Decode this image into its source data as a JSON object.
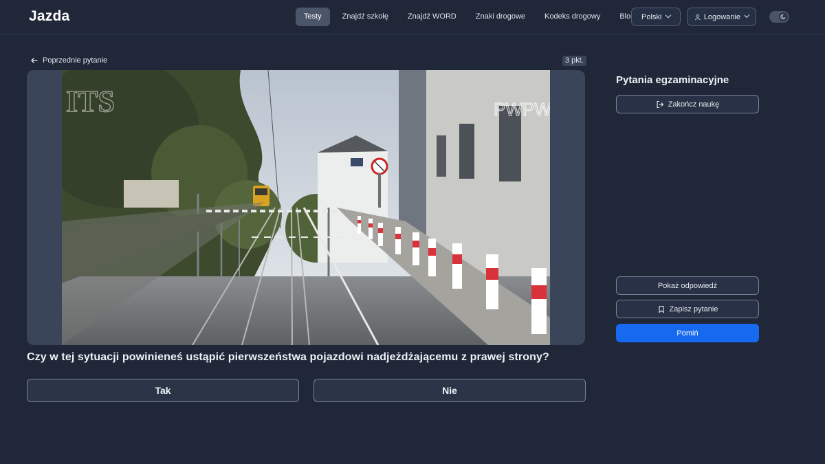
{
  "header": {
    "logo": "Jazda",
    "nav": [
      {
        "label": "Testy",
        "active": true
      },
      {
        "label": "Znajdź szkołę",
        "active": false
      },
      {
        "label": "Znajdź WORD",
        "active": false
      },
      {
        "label": "Znaki drogowe",
        "active": false
      },
      {
        "label": "Kodeks drogowy",
        "active": false
      },
      {
        "label": "Blog",
        "active": false
      }
    ],
    "language": "Polski",
    "login": "Logowanie",
    "theme_icon": "moon-icon"
  },
  "question": {
    "back_label": "Poprzednie pytanie",
    "points": "3 pkt.",
    "media_watermarks": [
      "ITS",
      "PWPW"
    ],
    "text": "Czy w tej sytuacji powinieneś ustąpić pierwszeństwa pojazdowi nadjeżdżającemu z prawej strony?",
    "answers": [
      "Tak",
      "Nie"
    ]
  },
  "sidebar": {
    "title": "Pytania egzaminacyjne",
    "end_label": "Zakończ naukę",
    "show_answer_label": "Pokaż odpowiedź",
    "save_label": "Zapisz pytanie",
    "skip_label": "Pomiń"
  },
  "colors": {
    "background": "#1f2738",
    "primary": "#1769f0",
    "card": "#3b4559"
  }
}
